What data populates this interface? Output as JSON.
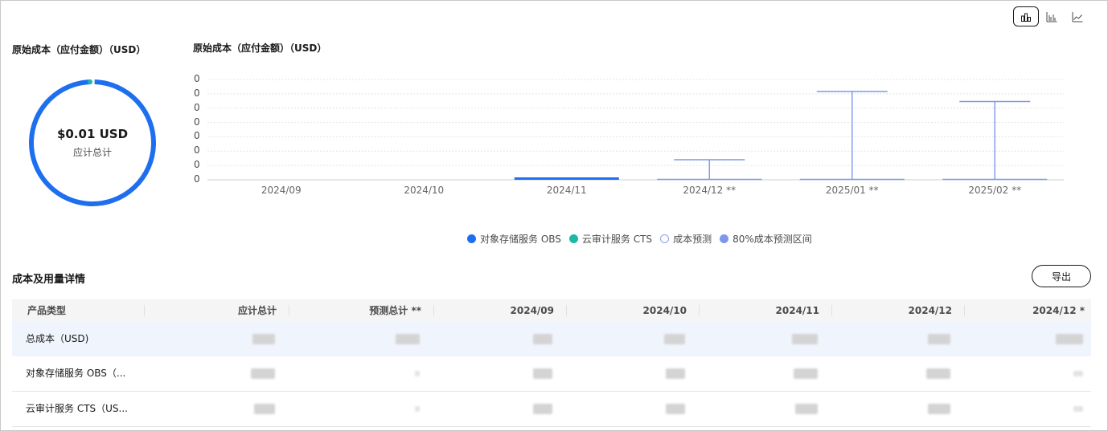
{
  "summary": {
    "title": "原始成本（应付金额）（USD）",
    "amount": "$0.01 USD",
    "amount_label": "应计总计"
  },
  "chart_data": {
    "type": "bar",
    "title": "原始成本（应付金额）（USD）",
    "categories": [
      "2024/09",
      "2024/10",
      "2024/11",
      "2024/12 **",
      "2025/01 **",
      "2025/02 **"
    ],
    "y_tick_labels": [
      "0",
      "0",
      "0",
      "0",
      "0",
      "0",
      "0",
      "0"
    ],
    "ylim": [
      0,
      0.01
    ],
    "grid": true,
    "series": [
      {
        "name": "对象存储服务 OBS",
        "values": [
          0,
          0,
          0.0001,
          0.0001,
          0.0001,
          0.0001
        ]
      },
      {
        "name": "云审计服务 CTS",
        "values": [
          0,
          0,
          0,
          0,
          0,
          0
        ]
      },
      {
        "name": "成本预测",
        "values": [
          null,
          null,
          null,
          0.0001,
          0.0001,
          0.0001
        ]
      }
    ],
    "forecast_interval": {
      "name": "80%成本预测区间",
      "low": [
        null,
        null,
        null,
        0,
        0,
        0
      ],
      "high": [
        null,
        null,
        null,
        0.002,
        0.0088,
        0.0078
      ]
    },
    "legend_position": "bottom"
  },
  "legend": [
    {
      "label": "对象存储服务 OBS",
      "color": "#1e6ff0",
      "style": "filled"
    },
    {
      "label": "云审计服务 CTS",
      "color": "#1eb8a6",
      "style": "filled"
    },
    {
      "label": "成本预测",
      "color": "#8aa0ee",
      "style": "hollow"
    },
    {
      "label": "80%成本预测区间",
      "color": "#7d97ec",
      "style": "filled"
    }
  ],
  "view_toggle": [
    {
      "icon": "bar-chart-icon",
      "active": true
    },
    {
      "icon": "grouped-bar-chart-icon",
      "active": false
    },
    {
      "icon": "line-chart-icon",
      "active": false
    }
  ],
  "details": {
    "title": "成本及用量详情",
    "export_label": "导出",
    "columns": [
      "产品类型",
      "应计总计",
      "预测总计 **",
      "2024/09",
      "2024/10",
      "2024/11",
      "2024/12",
      "2024/12 *"
    ],
    "rows": [
      {
        "name": "总成本（USD)"
      },
      {
        "name": "对象存储服务 OBS（..."
      },
      {
        "name": "云审计服务 CTS（US..."
      }
    ]
  },
  "colors": {
    "accent": "#1e6ff0",
    "teal": "#1eb8a6",
    "forecast": "#7d97ec"
  }
}
